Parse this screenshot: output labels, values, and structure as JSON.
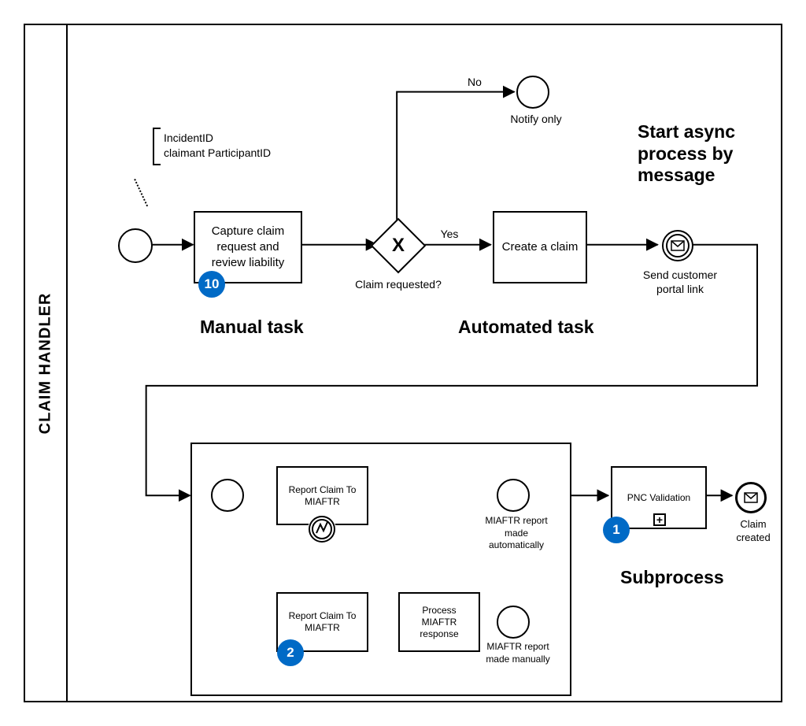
{
  "lane": {
    "name": "CLAIM HANDLER"
  },
  "annotation": {
    "text": "IncidentID\nclaimant ParticipantID"
  },
  "tasks": {
    "capture": "Capture claim request and review liability",
    "create": "Create a claim",
    "report1": "Report Claim To MIAFTR",
    "report2": "Report Claim To MIAFTR",
    "process_resp": "Process MIAFTR response",
    "pnc": "PNC Validation"
  },
  "gateway": {
    "label": "Claim requested?",
    "yes": "Yes",
    "no": "No",
    "symbol": "X"
  },
  "events": {
    "notify_only": "Notify only",
    "send_portal": "Send customer portal link",
    "miaftr_auto": "MIAFTR report made automatically",
    "miaftr_manual": "MIAFTR report made manually",
    "claim_created": "Claim created"
  },
  "big_labels": {
    "manual": "Manual task",
    "automated": "Automated task",
    "async": "Start async process by message",
    "subprocess": "Subprocess"
  },
  "badges": {
    "ten": "10",
    "two": "2",
    "one": "1"
  },
  "chart_data": {
    "type": "BPMN process diagram",
    "pool": "CLAIM HANDLER",
    "nodes": [
      {
        "id": "start",
        "type": "startEvent"
      },
      {
        "id": "capture",
        "type": "userTask",
        "label": "Capture claim request and review liability",
        "badge": 10,
        "annotation": "IncidentID; claimant ParticipantID",
        "categoryLabel": "Manual task"
      },
      {
        "id": "gw",
        "type": "exclusiveGateway",
        "label": "Claim requested?"
      },
      {
        "id": "notify",
        "type": "endEvent",
        "label": "Notify only"
      },
      {
        "id": "create",
        "type": "serviceTask",
        "label": "Create a claim",
        "categoryLabel": "Automated task"
      },
      {
        "id": "sendPortal",
        "type": "intermediateMessageThrowEvent",
        "label": "Send customer portal link",
        "categoryLabel": "Start async process by message"
      },
      {
        "id": "sub",
        "type": "subProcess",
        "children": [
          {
            "id": "sub_start",
            "type": "startEvent"
          },
          {
            "id": "report1",
            "type": "serviceTask",
            "label": "Report Claim To MIAFTR",
            "boundary": "error"
          },
          {
            "id": "miaftrAuto",
            "type": "endEvent",
            "label": "MIAFTR report made automatically"
          },
          {
            "id": "report2",
            "type": "userTask",
            "label": "Report Claim To MIAFTR",
            "badge": 2
          },
          {
            "id": "procResp",
            "type": "task",
            "label": "Process MIAFTR response"
          },
          {
            "id": "miaftrManual",
            "type": "endEvent",
            "label": "MIAFTR report made manually"
          }
        ],
        "innerFlows": [
          {
            "from": "sub_start",
            "to": "report1"
          },
          {
            "from": "report1",
            "to": "miaftrAuto"
          },
          {
            "from": "report1",
            "to": "report2",
            "via": "boundaryError"
          },
          {
            "from": "report2",
            "to": "procResp"
          },
          {
            "from": "procResp",
            "to": "miaftrManual"
          }
        ]
      },
      {
        "id": "pnc",
        "type": "callActivity",
        "label": "PNC Validation",
        "badge": 1,
        "categoryLabel": "Subprocess"
      },
      {
        "id": "claimCreated",
        "type": "messageEndEvent",
        "label": "Claim created"
      }
    ],
    "flows": [
      {
        "from": "start",
        "to": "capture"
      },
      {
        "from": "capture",
        "to": "gw"
      },
      {
        "from": "gw",
        "to": "notify",
        "condition": "No"
      },
      {
        "from": "gw",
        "to": "create",
        "condition": "Yes"
      },
      {
        "from": "create",
        "to": "sendPortal"
      },
      {
        "from": "sendPortal",
        "to": "sub"
      },
      {
        "from": "sub",
        "to": "pnc"
      },
      {
        "from": "pnc",
        "to": "claimCreated"
      }
    ]
  }
}
